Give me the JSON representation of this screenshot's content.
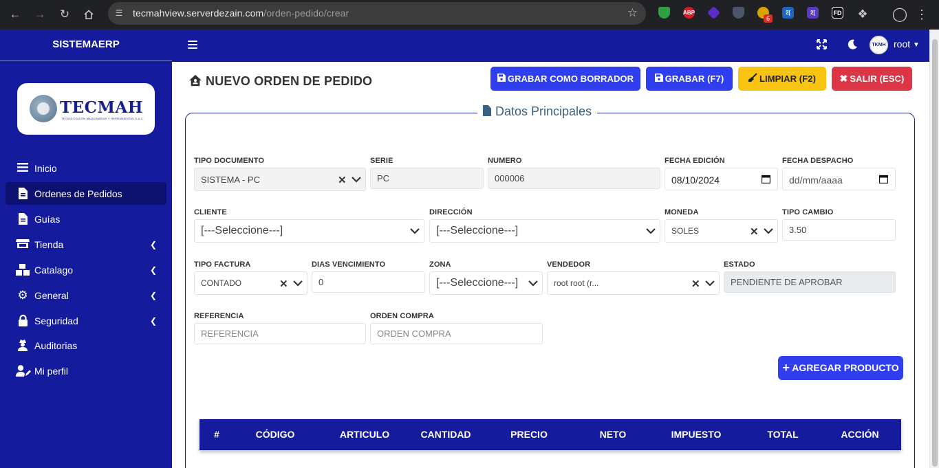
{
  "browser": {
    "url_host": "tecmahview.serverdezain.com",
    "url_path": "/orden-pedido/crear",
    "extension_badge": "6",
    "extensions": [
      {
        "name": "shield-extension-icon",
        "label": "",
        "color": "#2ea043"
      },
      {
        "name": "abp-extension-icon",
        "label": "ABP",
        "color": "#d01b29"
      },
      {
        "name": "gem-extension-icon",
        "label": "",
        "color": "#5b2dc6"
      },
      {
        "name": "bitwarden-extension-icon",
        "label": "",
        "color": "#4a5568"
      },
      {
        "name": "bulb-extension-icon",
        "label": "",
        "color": "#d9a400"
      },
      {
        "name": "translate-extension-icon-1",
        "label": "2[",
        "color": "#1e66c5"
      },
      {
        "name": "translate-extension-icon-2",
        "label": "2[",
        "color": "#5a39c4"
      },
      {
        "name": "fd-extension-icon",
        "label": "FD",
        "color": "#111111"
      }
    ]
  },
  "sidebar": {
    "brand": "SISTEMAERP",
    "logo_text": "TECMAH",
    "logo_sub": "TECNOLOGIA EN MAQUINARIAS Y HERRAMIENTAS S.A.C.",
    "items": [
      {
        "label": "Inicio",
        "icon": "list-icon",
        "caret": false
      },
      {
        "label": "Ordenes de Pedidos",
        "icon": "file-icon",
        "caret": false,
        "active": true
      },
      {
        "label": "Guías",
        "icon": "file-icon",
        "caret": false
      },
      {
        "label": "Tienda",
        "icon": "store-icon",
        "caret": true
      },
      {
        "label": "Catalago",
        "icon": "boxes-icon",
        "caret": true
      },
      {
        "label": "General",
        "icon": "gears-icon",
        "caret": true
      },
      {
        "label": "Seguridad",
        "icon": "lock-icon",
        "caret": true
      },
      {
        "label": "Auditorias",
        "icon": "user-secret-icon",
        "caret": false
      },
      {
        "label": "Mi perfil",
        "icon": "user-edit-icon",
        "caret": false
      }
    ]
  },
  "topnav": {
    "user": "root",
    "avatar_text": "TKMH"
  },
  "page": {
    "title": "NUEVO ORDEN DE PEDIDO",
    "buttons": {
      "draft": "GRABAR COMO BORRADOR",
      "save": "GRABAR (F7)",
      "clear": "LIMPIAR (F2)",
      "exit": "SALIR (ESC)"
    },
    "section_title": "Datos Principales",
    "fields": {
      "tipo_documento": {
        "label": "TIPO DOCUMENTO",
        "value": "SISTEMA - PC"
      },
      "serie": {
        "label": "SERIE",
        "value": "PC"
      },
      "numero": {
        "label": "NUMERO",
        "value": "000006"
      },
      "fecha_edicion": {
        "label": "FECHA EDICIÓN",
        "value": "08/10/2024"
      },
      "fecha_despacho": {
        "label": "FECHA DESPACHO",
        "value": "dd/mm/aaaa"
      },
      "cliente": {
        "label": "CLIENTE",
        "value": "[---Seleccione---]"
      },
      "direccion": {
        "label": "DIRECCIÓN",
        "value": "[---Seleccione---]"
      },
      "moneda": {
        "label": "MONEDA",
        "value": "SOLES"
      },
      "tipo_cambio": {
        "label": "TIPO CAMBIO",
        "value": "3.50"
      },
      "tipo_factura": {
        "label": "TIPO FACTURA",
        "value": "CONTADO"
      },
      "dias_vencimiento": {
        "label": "DIAS VENCIMIENTO",
        "value": "0"
      },
      "zona": {
        "label": "ZONA",
        "value": "[---Seleccione---]"
      },
      "vendedor": {
        "label": "VENDEDOR",
        "value": "root root (r..."
      },
      "estado": {
        "label": "ESTADO",
        "value": "PENDIENTE DE APROBAR"
      },
      "referencia": {
        "label": "REFERENCIA",
        "placeholder": "REFERENCIA"
      },
      "orden_compra": {
        "label": "ORDEN COMPRA",
        "placeholder": "ORDEN COMPRA"
      }
    },
    "add_product": "AGREGAR PRODUCTO",
    "table_headers": [
      "#",
      "CÓDIGO",
      "ARTICULO",
      "CANTIDAD",
      "PRECIO",
      "NETO",
      "IMPUESTO",
      "TOTAL",
      "ACCIÓN"
    ]
  }
}
